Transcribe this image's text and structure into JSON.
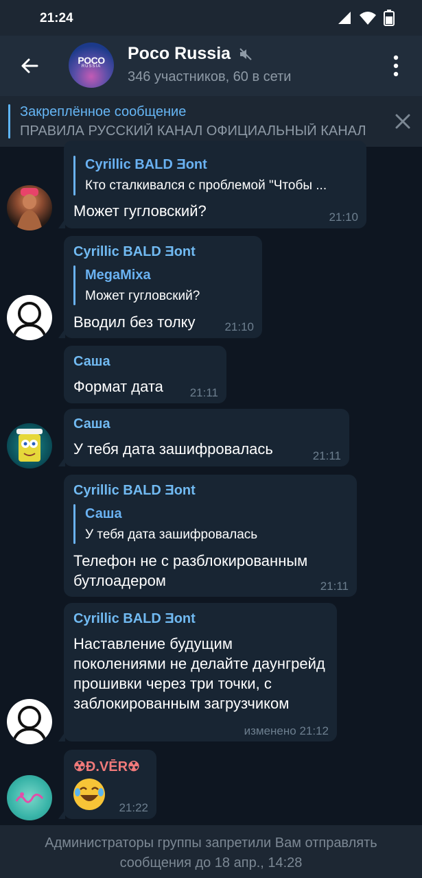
{
  "status": {
    "time": "21:24",
    "battery": "44"
  },
  "header": {
    "title": "Poco Russia",
    "subtitle": "346 участников, 60 в сети",
    "avatar_logo": "POCO",
    "avatar_logo_sub": "RUSSIA"
  },
  "pinned": {
    "title": "Закреплённое сообщение",
    "text": "ПРАВИЛА РУССКИЙ КАНАЛ ОФИЦИАЛЬНЫЙ КАНАЛ"
  },
  "messages": [
    {
      "sender": "",
      "reply_name": "Cyrillic BALD Ǝont",
      "reply_text": "Кто сталкивался с проблемой \"Чтобы ...",
      "text": "Может гугловский?",
      "time": "21:10"
    },
    {
      "sender": "Cyrillic BALD Ǝont",
      "reply_name": "MegaMixa",
      "reply_text": "Может гугловский?",
      "text": "Вводил без толку",
      "time": "21:10"
    },
    {
      "sender": "Саша",
      "text": "Формат дата",
      "time": "21:11"
    },
    {
      "sender": "Саша",
      "text": "У тебя дата зашифровалась",
      "time": "21:11"
    },
    {
      "sender": "Cyrillic BALD Ǝont",
      "reply_name": "Саша",
      "reply_text": "У тебя дата зашифровалась",
      "text": "Телефон не с разблокированным бутлоадером",
      "time": "21:11"
    },
    {
      "sender": "Cyrillic BALD Ǝont",
      "text": "Наставление будущим поколениями не делайте даунгрейд прошивки через три точки, с заблокированным загрузчиком",
      "time": "изменено 21:12"
    },
    {
      "sender": "☢Đ.VĒR☢",
      "sender_color": "#f07a7a",
      "text": "😂",
      "time": "21:22"
    }
  ],
  "bottom_notice": "Администраторы группы запретили Вам отправлять сообщения до 18 апр., 14:28",
  "colors": {
    "background": "#0e1621",
    "bubble": "#182533",
    "header": "#212d3b",
    "accent": "#71baf2"
  }
}
